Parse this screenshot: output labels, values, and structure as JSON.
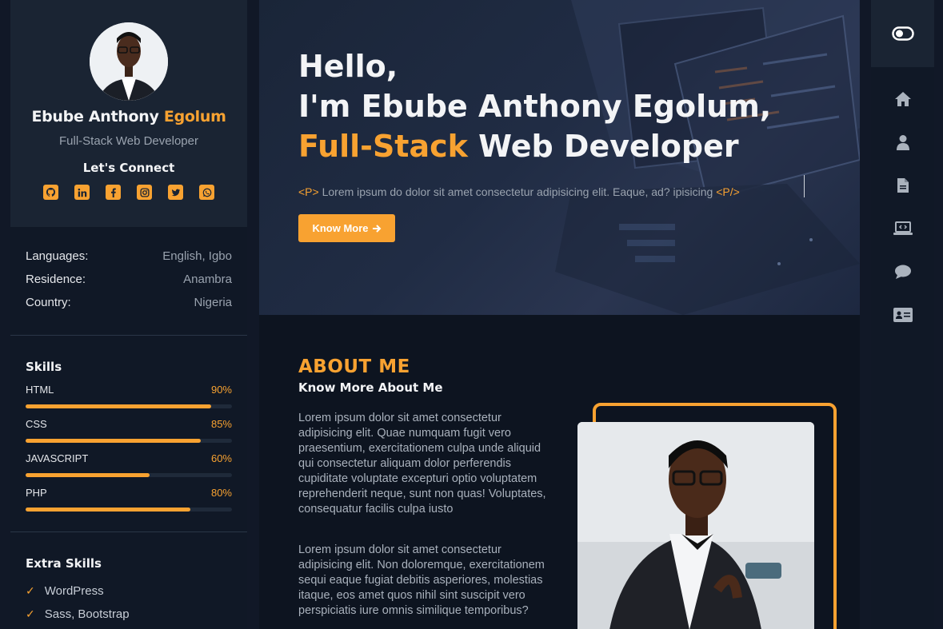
{
  "profile": {
    "name_first": "Ebube Anthony",
    "name_last": "Egolum",
    "role": "Full-Stack Web Developer",
    "connect_heading": "Let's Connect",
    "socials": [
      "github-icon",
      "linkedin-icon",
      "facebook-icon",
      "instagram-icon",
      "twitter-icon",
      "whatsapp-icon"
    ]
  },
  "info": [
    {
      "label": "Languages:",
      "value": "English, Igbo"
    },
    {
      "label": "Residence:",
      "value": "Anambra"
    },
    {
      "label": "Country:",
      "value": "Nigeria"
    }
  ],
  "skills": {
    "heading": "Skills",
    "items": [
      {
        "name": "HTML",
        "percent_label": "90%",
        "percent": 90
      },
      {
        "name": "CSS",
        "percent_label": "85%",
        "percent": 85
      },
      {
        "name": "JAVASCRIPT",
        "percent_label": "60%",
        "percent": 60
      },
      {
        "name": "PHP",
        "percent_label": "80%",
        "percent": 80
      }
    ]
  },
  "extra_skills": {
    "heading": "Extra Skills",
    "items": [
      "WordPress",
      "Sass, Bootstrap"
    ]
  },
  "hero": {
    "line1": "Hello,",
    "line2": "I'm Ebube Anthony Egolum,",
    "line3_accent": "Full-Stack",
    "line3_rest": " Web Developer",
    "tag_open": "<P>",
    "paragraph": " Lorem ipsum do dolor sit amet consectetur adipisicing elit. Eaque, ad? ipisicing ",
    "tag_close": "<P/>",
    "button_label": "Know More"
  },
  "about": {
    "heading": "ABOUT ME",
    "subheading": "Know More About Me",
    "paragraph1": "Lorem ipsum dolor sit amet consectetur adipisicing elit. Quae numquam fugit vero praesentium, exercitationem culpa unde aliquid qui consectetur aliquam dolor perferendis cupiditate voluptate excepturi optio voluptatem reprehenderit neque, sunt non quas! Voluptates, consequatur facilis culpa iusto",
    "paragraph2": "Lorem ipsum dolor sit amet consectetur adipisicing elit. Non doloremque, exercitationem sequi eaque fugiat debitis asperiores, molestias itaque, eos amet quos nihil sint suscipit vero perspiciatis iure omnis similique temporibus?"
  },
  "right_nav": {
    "toggle": "toggle-icon",
    "items": [
      "home-icon",
      "user-icon",
      "document-icon",
      "laptop-code-icon",
      "chat-icon",
      "contact-card-icon"
    ]
  },
  "colors": {
    "accent": "#f8a231",
    "bg": "#0d1420",
    "card": "#1a2433"
  }
}
